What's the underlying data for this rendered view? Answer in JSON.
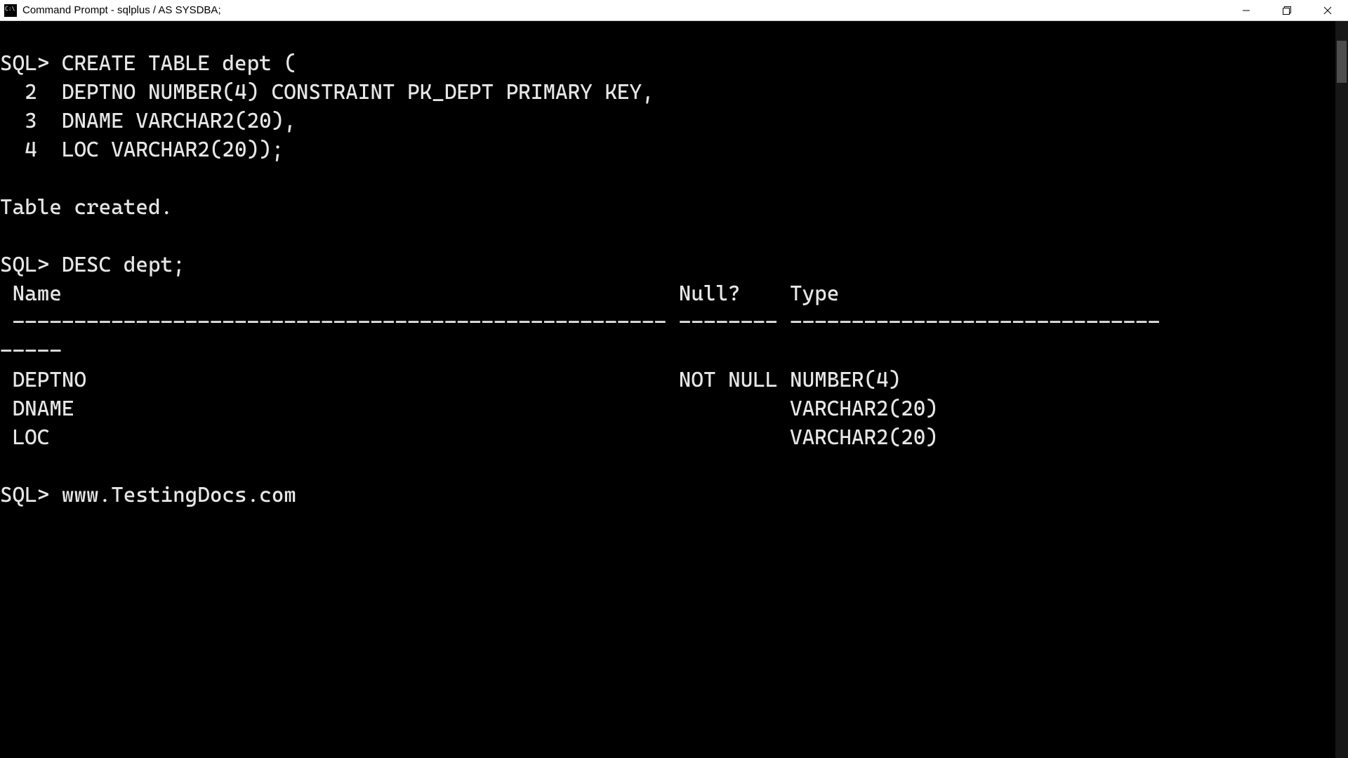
{
  "window": {
    "title": "Command Prompt - sqlplus  / AS SYSDBA;"
  },
  "terminal": {
    "lines": [
      "SQL> CREATE TABLE dept (",
      "  2  DEPTNO NUMBER(4) CONSTRAINT PK_DEPT PRIMARY KEY,",
      "  3  DNAME VARCHAR2(20),",
      "  4  LOC VARCHAR2(20));",
      "",
      "Table created.",
      "",
      "SQL> DESC dept;",
      " Name                                                  Null?    Type",
      " ----------------------------------------------------- -------- ------------------------------",
      "-----",
      " DEPTNO                                                NOT NULL NUMBER(4)",
      " DNAME                                                          VARCHAR2(20)",
      " LOC                                                            VARCHAR2(20)",
      "",
      "SQL> www.TestingDocs.com"
    ]
  }
}
